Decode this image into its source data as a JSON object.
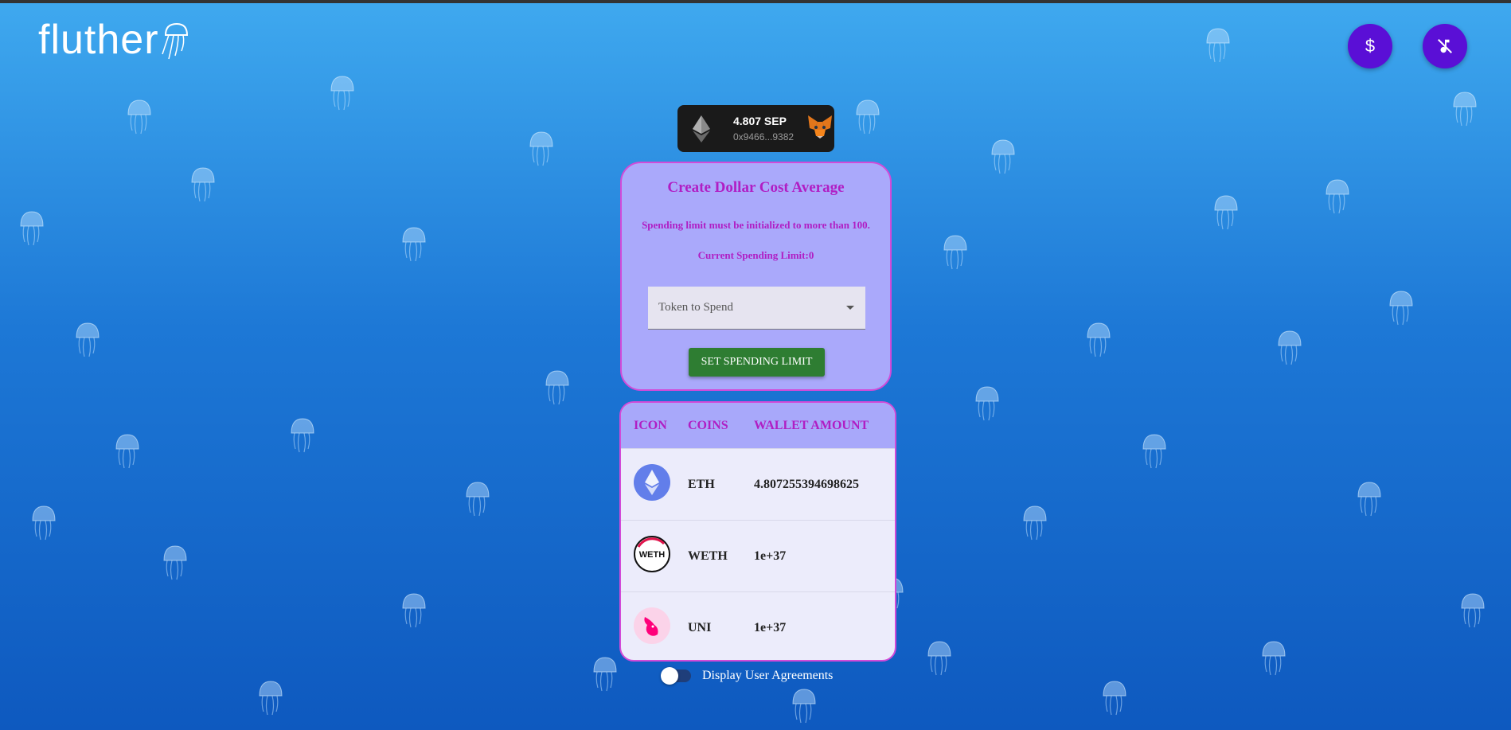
{
  "header": {
    "logo_text": "fluther",
    "dollar_button_icon": "dollar-icon",
    "music_off_button_icon": "music-off-icon"
  },
  "wallet": {
    "balance": "4.807 SEP",
    "address": "0x9466...9382"
  },
  "dca_card": {
    "title": "Create Dollar Cost Average",
    "warning": "Spending limit must be initialized to more than 100.",
    "current_limit": "Current Spending Limit:0",
    "select_placeholder": "Token to Spend",
    "set_button_label": "SET SPENDING LIMIT"
  },
  "table": {
    "headers": [
      "ICON",
      "COINS",
      "WALLET AMOUNT"
    ],
    "rows": [
      {
        "icon": "eth-icon",
        "coin": "ETH",
        "amount": "4.807255394698625"
      },
      {
        "icon": "weth-icon",
        "coin": "WETH",
        "amount": "1e+37",
        "icon_text": "WETH"
      },
      {
        "icon": "uni-icon",
        "coin": "UNI",
        "amount": "1e+37"
      }
    ]
  },
  "toggle": {
    "label": "Display User Agreements",
    "checked": false
  },
  "colors": {
    "accent_purple": "#5a0fd6",
    "card_bg": "#aaa9fb",
    "card_border": "#d24ad8",
    "heading_magenta": "#b01ec4",
    "button_green": "#2e7d32"
  }
}
